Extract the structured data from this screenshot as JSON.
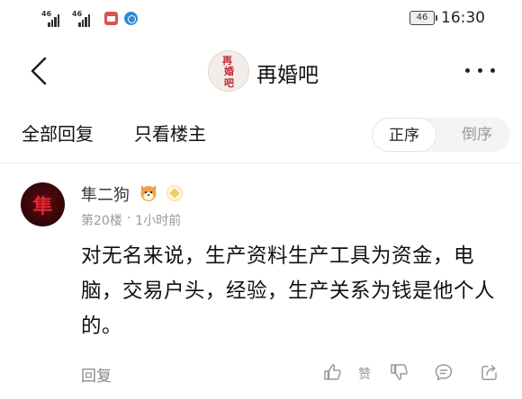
{
  "status_bar": {
    "signal_1": "46",
    "signal_2": "46",
    "battery": "46",
    "time": "16:30"
  },
  "header": {
    "bar_name": "再婚吧",
    "avatar_text": [
      "再",
      "婚",
      "吧"
    ]
  },
  "tabs": {
    "all_replies": "全部回复",
    "op_only": "只看楼主"
  },
  "order": {
    "asc": "正序",
    "desc": "倒序",
    "selected": "正序"
  },
  "post": {
    "avatar_char": "隼",
    "username": "隼二狗",
    "floor": "第20楼",
    "separator": "·",
    "time_ago": "1小时前",
    "content": "对无名来说，生产资料生产工具为资金，电脑，交易户头，经验，生产关系为钱是他个人的。"
  },
  "actions": {
    "reply": "回复",
    "like": "赞"
  },
  "colors": {
    "accent_red": "#c22a33",
    "muted_text": "#9a9a9a",
    "icon_gray": "#999999"
  }
}
